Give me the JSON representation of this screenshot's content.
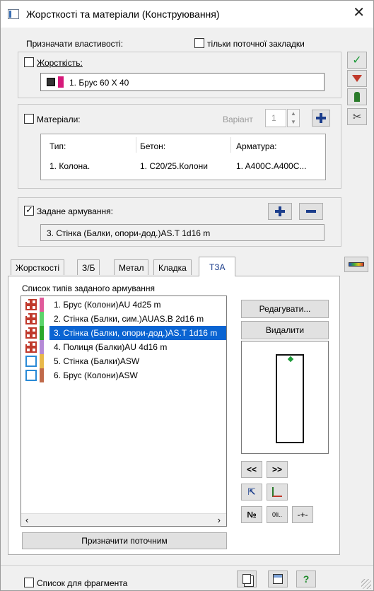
{
  "window": {
    "title": "Жорсткості та матеріали (Конструювання)",
    "close_label": "✕"
  },
  "assign": {
    "label": "Призначати властивості:",
    "only_current_label": "тільки поточної закладки"
  },
  "stiffness": {
    "label": "Жорсткість:",
    "value": "1. Брус 60 X 40"
  },
  "materials": {
    "label": "Матеріали:",
    "variant_label": "Варіант",
    "variant_value": "1",
    "columns": [
      "Тип:",
      "Бетон:",
      "Арматура:"
    ],
    "row": [
      "1. Колона.",
      "1. C20/25.Колони",
      "1. A400C.A400C..."
    ]
  },
  "reinforcement": {
    "label": "Задане армування:",
    "value": "3. Стінка (Балки, опори-дод.)AS.T 1d16 m"
  },
  "tabs": [
    "Жорсткості",
    "З/Б",
    "Метал",
    "Кладка",
    "ТЗА"
  ],
  "active_tab": "ТЗА",
  "tza": {
    "list_title": "Список типів заданого армування",
    "items": [
      {
        "label": "1. Брус (Колони)AU 4d25 m",
        "icon": "rebar-section-icon",
        "color": "#e05a9a"
      },
      {
        "label": "2. Стінка (Балки, сим.)AUAS.B 2d16 m",
        "icon": "rebar-section-icon",
        "color": "#5ad46a"
      },
      {
        "label": "3. Стінка (Балки, опори-дод.)AS.T 1d16 m",
        "icon": "rebar-section-icon",
        "color": "#2aa82a",
        "selected": true
      },
      {
        "label": "4. Полиця (Балки)AU 4d16 m",
        "icon": "rebar-section-icon",
        "color": "#b48ad6"
      },
      {
        "label": "5. Стінка (Балки)ASW",
        "icon": "stirrup-icon",
        "color": "#e8b84a"
      },
      {
        "label": "6. Брус (Колони)ASW",
        "icon": "stirrup-icon",
        "color": "#c06a4a"
      }
    ],
    "edit_label": "Редагувати...",
    "delete_label": "Видалити",
    "assign_current_label": "Призначити поточним",
    "prev_label": "<<",
    "next_label": ">>",
    "number_label": "№",
    "small_btn_label": "0li..",
    "plusminus_label": "-+-"
  },
  "footer": {
    "fragment_label": "Список для фрагмента",
    "help_label": "?"
  }
}
